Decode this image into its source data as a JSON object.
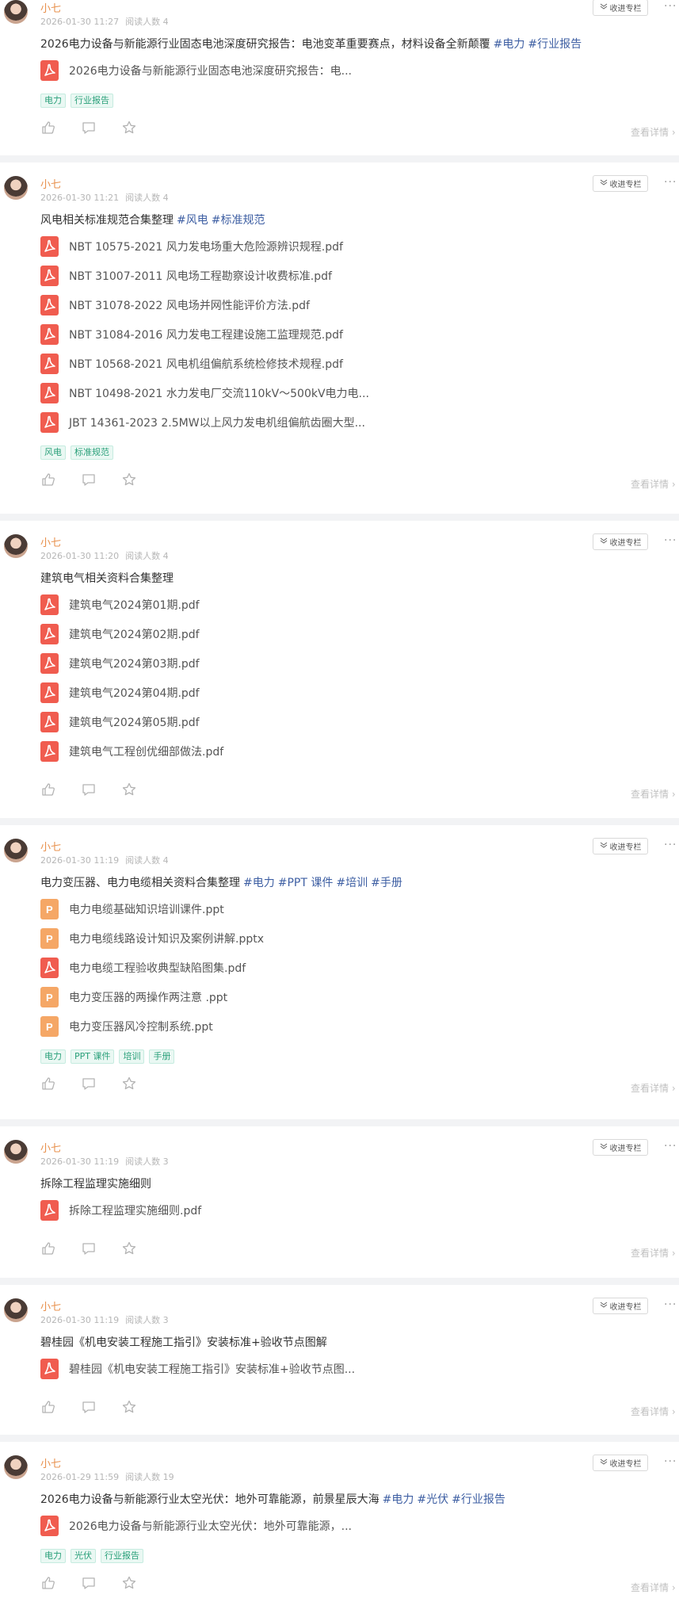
{
  "collect_label": "收进专栏",
  "more_label": "···",
  "detail_label": "查看详情 ›",
  "colors": {
    "author": "#e8904c",
    "hashtag": "#3e5fa3",
    "tag_text": "#2aa07a",
    "pdf": "#f05c4f",
    "ppt": "#f5a766"
  },
  "posts": [
    {
      "author": "小七",
      "date": "2026-01-30 11:27",
      "reads": "阅读人数 4",
      "title": "2026电力设备与新能源行业固态电池深度研究报告：电池变革重要赛点，材料设备全新颠覆",
      "hashtags": [
        "#电力",
        "#行业报告"
      ],
      "files": [
        {
          "type": "pdf",
          "icon": "pdf-file-icon",
          "name": "2026电力设备与新能源行业固态电池深度研究报告：电..."
        }
      ],
      "tags": [
        "电力",
        "行业报告"
      ]
    },
    {
      "author": "小七",
      "date": "2026-01-30 11:21",
      "reads": "阅读人数 4",
      "title": "风电相关标准规范合集整理",
      "hashtags": [
        "#风电",
        "#标准规范"
      ],
      "files": [
        {
          "type": "pdf",
          "icon": "pdf-file-icon",
          "name": "NBT 10575-2021 风力发电场重大危险源辨识规程.pdf"
        },
        {
          "type": "pdf",
          "icon": "pdf-file-icon",
          "name": "NBT 31007-2011 风电场工程勘察设计收费标准.pdf"
        },
        {
          "type": "pdf",
          "icon": "pdf-file-icon",
          "name": "NBT 31078-2022 风电场并网性能评价方法.pdf"
        },
        {
          "type": "pdf",
          "icon": "pdf-file-icon",
          "name": "NBT 31084-2016 风力发电工程建设施工监理规范.pdf"
        },
        {
          "type": "pdf",
          "icon": "pdf-file-icon",
          "name": "NBT 10568-2021 风电机组偏航系统检修技术规程.pdf"
        },
        {
          "type": "pdf",
          "icon": "pdf-file-icon",
          "name": "NBT 10498-2021 水力发电厂交流110kV～500kV电力电..."
        },
        {
          "type": "pdf",
          "icon": "pdf-file-icon",
          "name": "JBT 14361-2023 2.5MW以上风力发电机组偏航齿圈大型..."
        }
      ],
      "tags": [
        "风电",
        "标准规范"
      ]
    },
    {
      "author": "小七",
      "date": "2026-01-30 11:20",
      "reads": "阅读人数 4",
      "title": "建筑电气相关资料合集整理",
      "hashtags": [],
      "files": [
        {
          "type": "pdf",
          "icon": "pdf-file-icon",
          "name": "建筑电气2024第01期.pdf"
        },
        {
          "type": "pdf",
          "icon": "pdf-file-icon",
          "name": "建筑电气2024第02期.pdf"
        },
        {
          "type": "pdf",
          "icon": "pdf-file-icon",
          "name": "建筑电气2024第03期.pdf"
        },
        {
          "type": "pdf",
          "icon": "pdf-file-icon",
          "name": "建筑电气2024第04期.pdf"
        },
        {
          "type": "pdf",
          "icon": "pdf-file-icon",
          "name": "建筑电气2024第05期.pdf"
        },
        {
          "type": "pdf",
          "icon": "pdf-file-icon",
          "name": "建筑电气工程创优细部做法.pdf"
        }
      ],
      "tags": []
    },
    {
      "author": "小七",
      "date": "2026-01-30 11:19",
      "reads": "阅读人数 4",
      "title": "电力变压器、电力电缆相关资料合集整理",
      "hashtags": [
        "#电力",
        "#PPT 课件",
        "#培训",
        "#手册"
      ],
      "files": [
        {
          "type": "ppt",
          "icon": "ppt-file-icon",
          "name": "电力电缆基础知识培训课件.ppt"
        },
        {
          "type": "ppt",
          "icon": "ppt-file-icon",
          "name": "电力电缆线路设计知识及案例讲解.pptx"
        },
        {
          "type": "pdf",
          "icon": "pdf-file-icon",
          "name": "电力电缆工程验收典型缺陷图集.pdf"
        },
        {
          "type": "ppt",
          "icon": "ppt-file-icon",
          "name": "电力变压器的两操作两注意 .ppt"
        },
        {
          "type": "ppt",
          "icon": "ppt-file-icon",
          "name": "电力变压器风冷控制系统.ppt"
        }
      ],
      "tags": [
        "电力",
        "PPT 课件",
        "培训",
        "手册"
      ]
    },
    {
      "author": "小七",
      "date": "2026-01-30 11:19",
      "reads": "阅读人数 3",
      "title": "拆除工程监理实施细则",
      "hashtags": [],
      "files": [
        {
          "type": "pdf",
          "icon": "pdf-file-icon",
          "name": "拆除工程监理实施细则.pdf"
        }
      ],
      "tags": []
    },
    {
      "author": "小七",
      "date": "2026-01-30 11:19",
      "reads": "阅读人数 3",
      "title": "碧桂园《机电安装工程施工指引》安装标准+验收节点图解",
      "hashtags": [],
      "files": [
        {
          "type": "pdf",
          "icon": "pdf-file-icon",
          "name": "碧桂园《机电安装工程施工指引》安装标准+验收节点图..."
        }
      ],
      "tags": []
    },
    {
      "author": "小七",
      "date": "2026-01-29 11:59",
      "reads": "阅读人数 19",
      "title": "2026电力设备与新能源行业太空光伏：地外可靠能源，前景星辰大海",
      "hashtags": [
        "#电力",
        "#光伏",
        "#行业报告"
      ],
      "files": [
        {
          "type": "pdf",
          "icon": "pdf-file-icon",
          "name": "2026电力设备与新能源行业太空光伏：地外可靠能源，..."
        }
      ],
      "tags": [
        "电力",
        "光伏",
        "行业报告"
      ]
    }
  ]
}
